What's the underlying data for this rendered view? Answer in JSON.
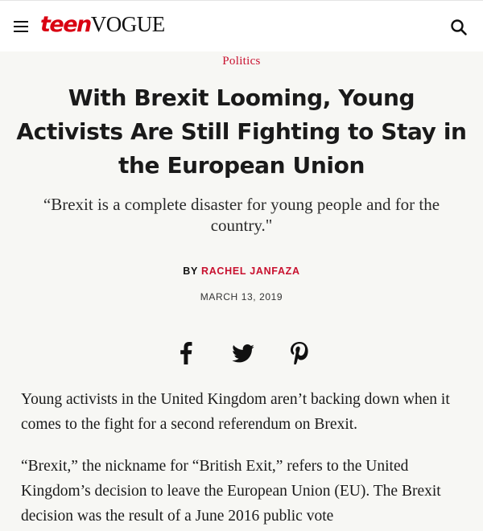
{
  "header": {
    "logo_teen": "teen",
    "logo_vogue": "VOGUE",
    "menu_icon": "hamburger-menu-icon",
    "search_icon": "search-icon"
  },
  "article": {
    "category": "Politics",
    "title": "With Brexit Looming, Young Activists Are Still Fighting to Stay in the European Union",
    "dek": "“Brexit is a complete disaster for young people and for the country.\"",
    "byline_prefix": "BY",
    "author": "RACHEL JANFAZA",
    "date": "MARCH 13, 2019",
    "share": [
      "facebook-icon",
      "twitter-icon",
      "pinterest-icon"
    ],
    "paragraphs": [
      "Young activists in the United Kingdom aren’t backing down when it comes to the fight for a second referendum on Brexit.",
      "“Brexit,” the nickname for “British Exit,” refers to the United Kingdom’s decision to leave the European Union (EU). The Brexit decision was the result of a June 2016 public vote"
    ]
  },
  "colors": {
    "accent": "#c8102e",
    "logo_red": "#d90012",
    "background": "#f7f7f4",
    "header_background": "#ffffff",
    "text": "#1a1a1a"
  }
}
